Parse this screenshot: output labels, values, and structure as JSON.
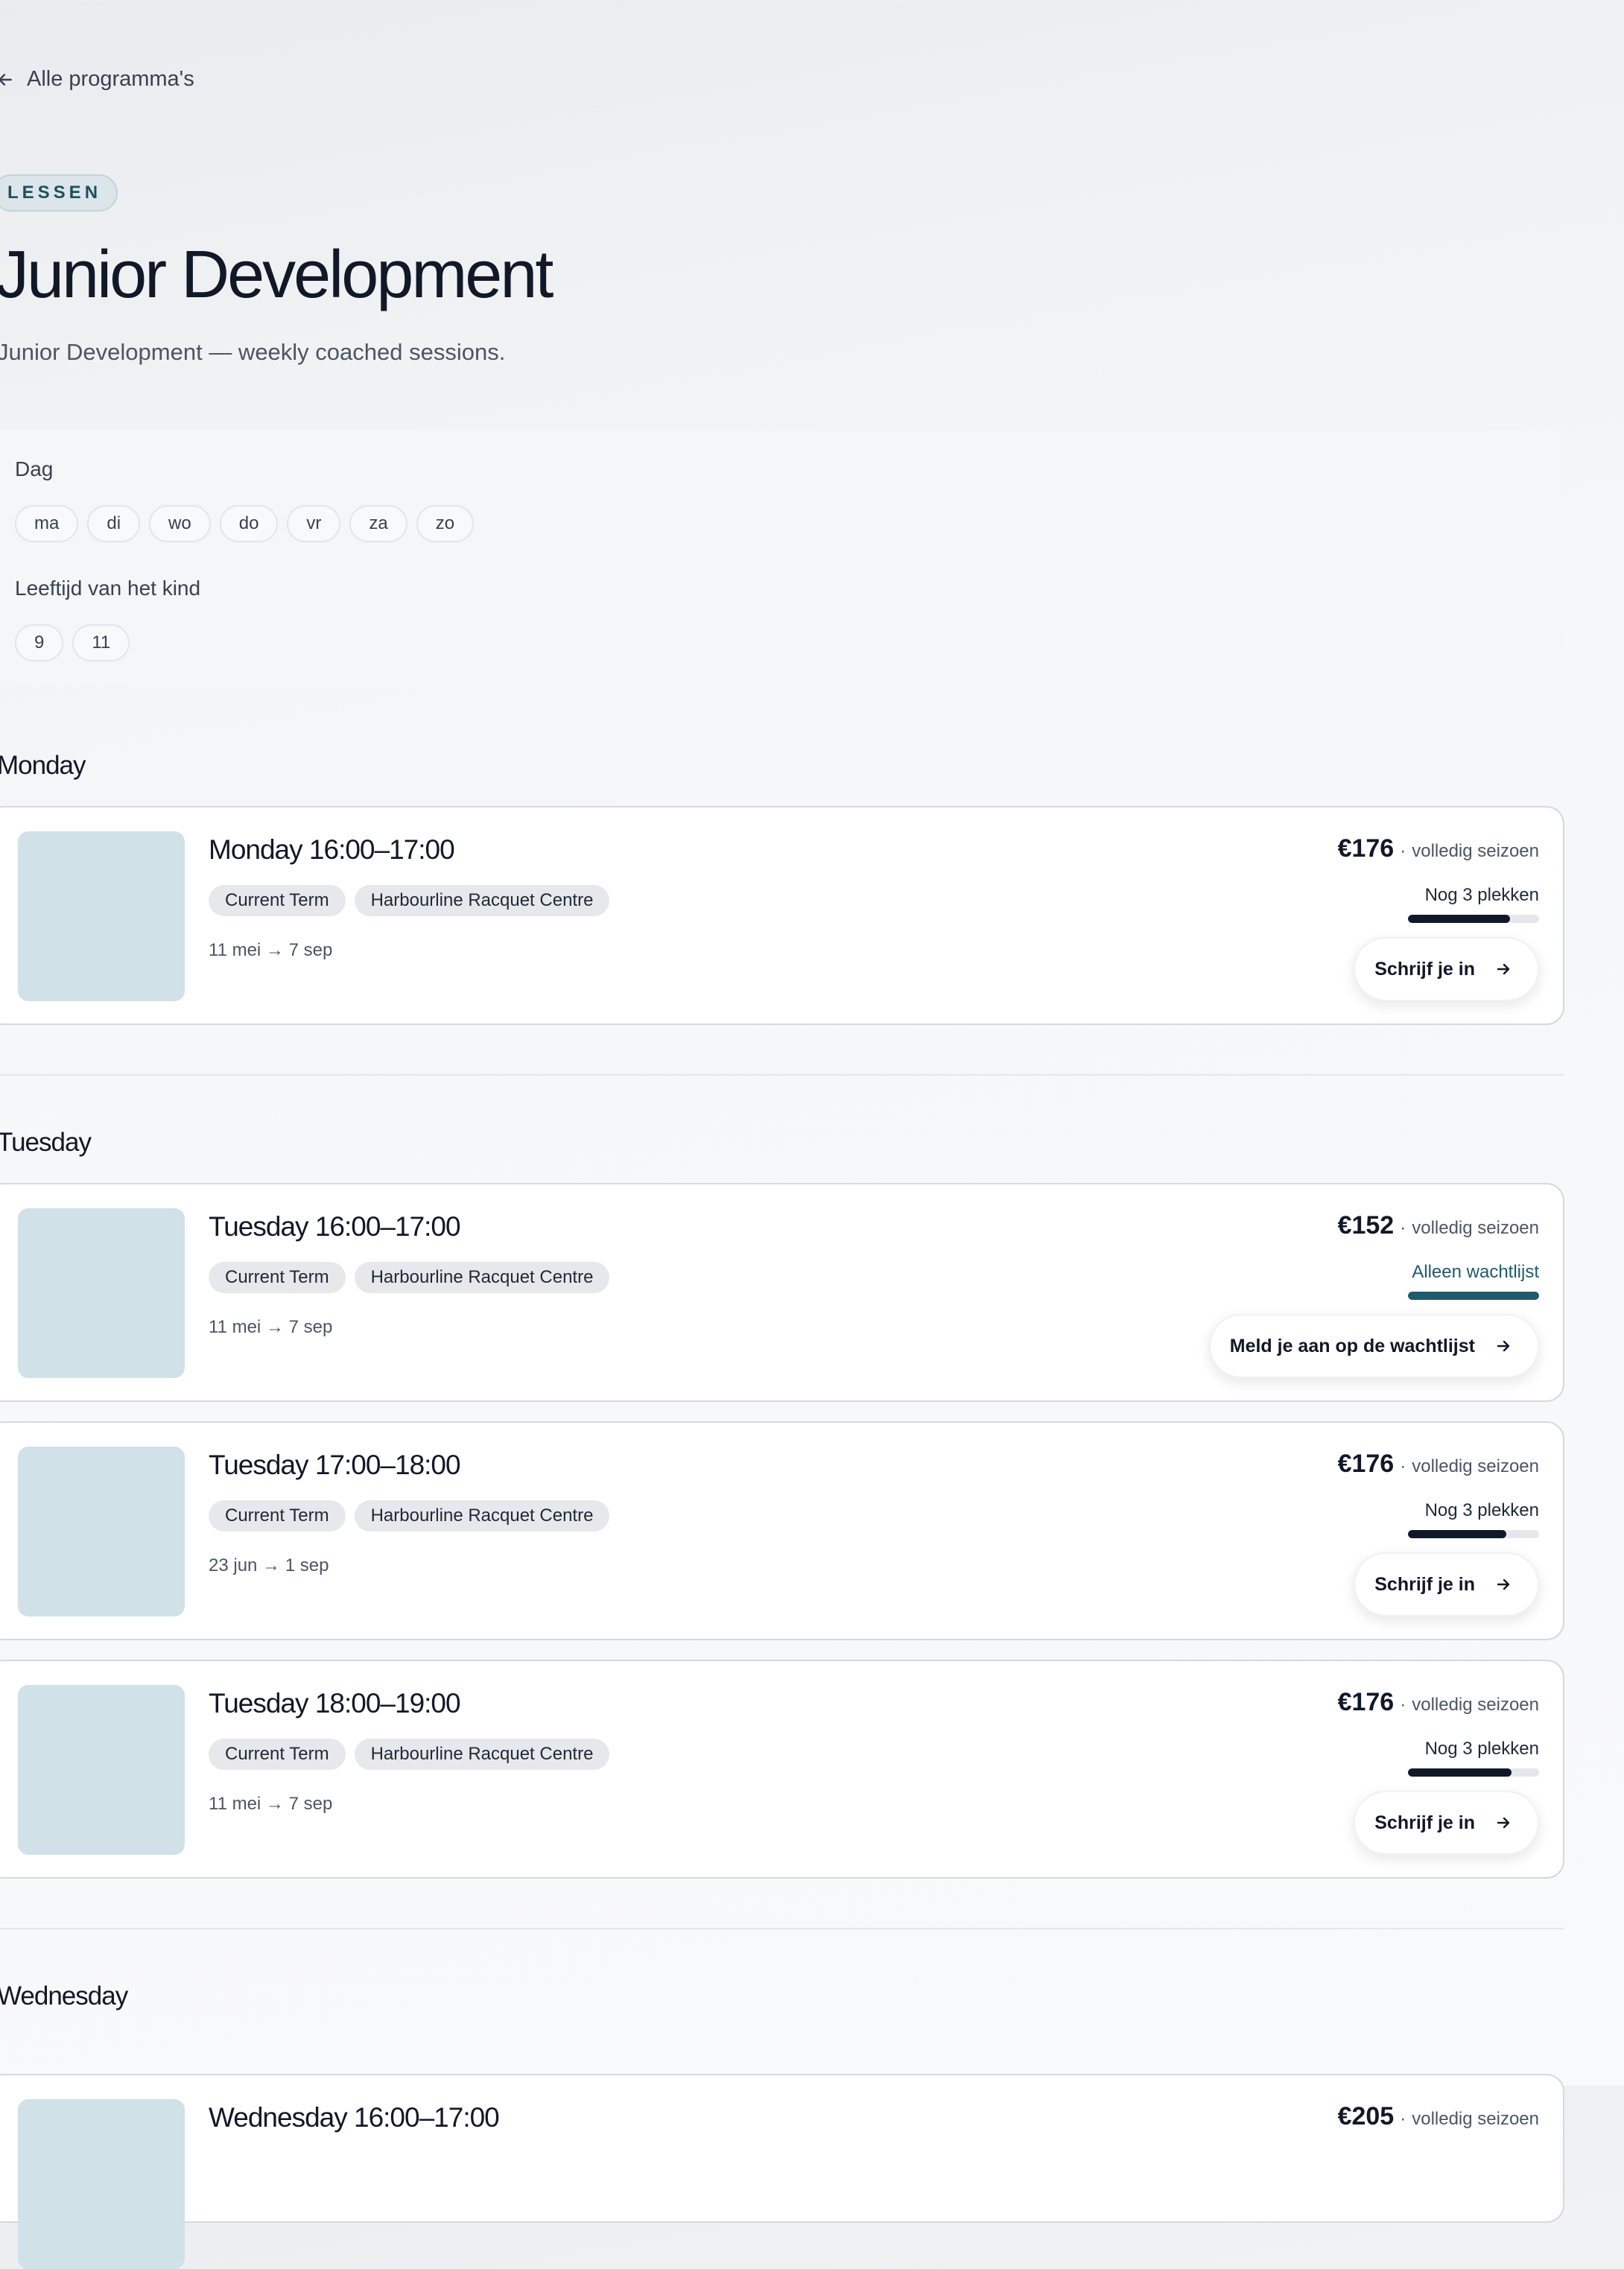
{
  "nav": {
    "back_label": "Alle programma's"
  },
  "header": {
    "category": "LESSEN",
    "title": "Junior Development",
    "subtitle": "Junior Development — weekly coached sessions."
  },
  "filters": {
    "day": {
      "label": "Dag",
      "options": [
        "ma",
        "di",
        "wo",
        "do",
        "vr",
        "za",
        "zo"
      ]
    },
    "age": {
      "label": "Leeftijd van het kind",
      "options": [
        "9",
        "11"
      ]
    }
  },
  "days": [
    {
      "heading": "Monday",
      "sessions": [
        {
          "title": "Monday 16:00–17:00",
          "term": "Current Term",
          "venue": "Harbourline Racquet Centre",
          "dates": "11 mei → 7 sep",
          "price": "€176",
          "price_sep": "·",
          "price_note": "volledig seizoen",
          "availability": "Nog 3 plekken",
          "fill": 0.78,
          "waitlist": false,
          "action": "Schrijf je in"
        }
      ]
    },
    {
      "heading": "Tuesday",
      "sessions": [
        {
          "title": "Tuesday 16:00–17:00",
          "term": "Current Term",
          "venue": "Harbourline Racquet Centre",
          "dates": "11 mei → 7 sep",
          "price": "€152",
          "price_sep": "·",
          "price_note": "volledig seizoen",
          "availability": "Alleen wachtlijst",
          "fill": 1.0,
          "waitlist": true,
          "action": "Meld je aan op de wachtlijst"
        },
        {
          "title": "Tuesday 17:00–18:00",
          "term": "Current Term",
          "venue": "Harbourline Racquet Centre",
          "dates": "23 jun → 1 sep",
          "price": "€176",
          "price_sep": "·",
          "price_note": "volledig seizoen",
          "availability": "Nog 3 plekken",
          "fill": 0.75,
          "waitlist": false,
          "action": "Schrijf je in"
        },
        {
          "title": "Tuesday 18:00–19:00",
          "term": "Current Term",
          "venue": "Harbourline Racquet Centre",
          "dates": "11 mei → 7 sep",
          "price": "€176",
          "price_sep": "·",
          "price_note": "volledig seizoen",
          "availability": "Nog 3 plekken",
          "fill": 0.79,
          "waitlist": false,
          "action": "Schrijf je in"
        }
      ]
    },
    {
      "heading": "Wednesday",
      "sessions": [
        {
          "title": "Wednesday 16:00–17:00",
          "price": "€205",
          "price_sep": "·",
          "price_note": "volledig seizoen"
        }
      ]
    }
  ],
  "icons": {
    "back": "arrow-left-icon",
    "action": "arrow-right-icon"
  },
  "colors": {
    "accent": "#1f5a6e",
    "thumbnail": "#d0e1e8",
    "capacity": "#111827"
  }
}
